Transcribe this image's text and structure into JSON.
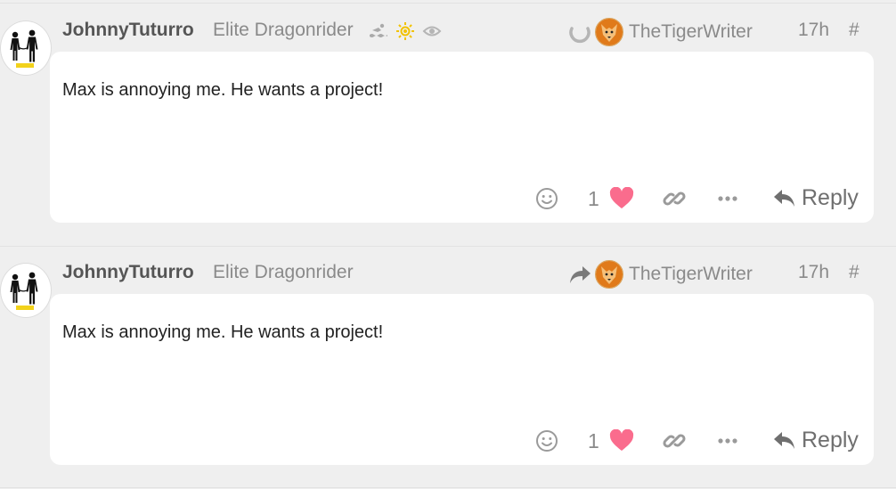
{
  "posts": [
    {
      "username": "JohnnyTuturro",
      "user_title": "Elite Dragonrider",
      "badges": [
        "swim-icon",
        "sun-icon",
        "eye-icon"
      ],
      "reply_status_icon": "loading-spinner-icon",
      "reply_to_user": "TheTigerWriter",
      "time": "17h",
      "hash": "#",
      "message": "Max is annoying me. He wants a project!",
      "like_count": "1",
      "reply_label": "Reply"
    },
    {
      "username": "JohnnyTuturro",
      "user_title": "Elite Dragonrider",
      "badges": [],
      "reply_status_icon": "share-arrow-icon",
      "reply_to_user": "TheTigerWriter",
      "time": "17h",
      "hash": "#",
      "message": "Max is annoying me. He wants a project!",
      "like_count": "1",
      "reply_label": "Reply"
    }
  ],
  "colors": {
    "background": "#efefef",
    "card": "#ffffff",
    "heart": "#fa6c8d",
    "muted": "#8a8a8a",
    "badge_sun": "#f2c200"
  }
}
